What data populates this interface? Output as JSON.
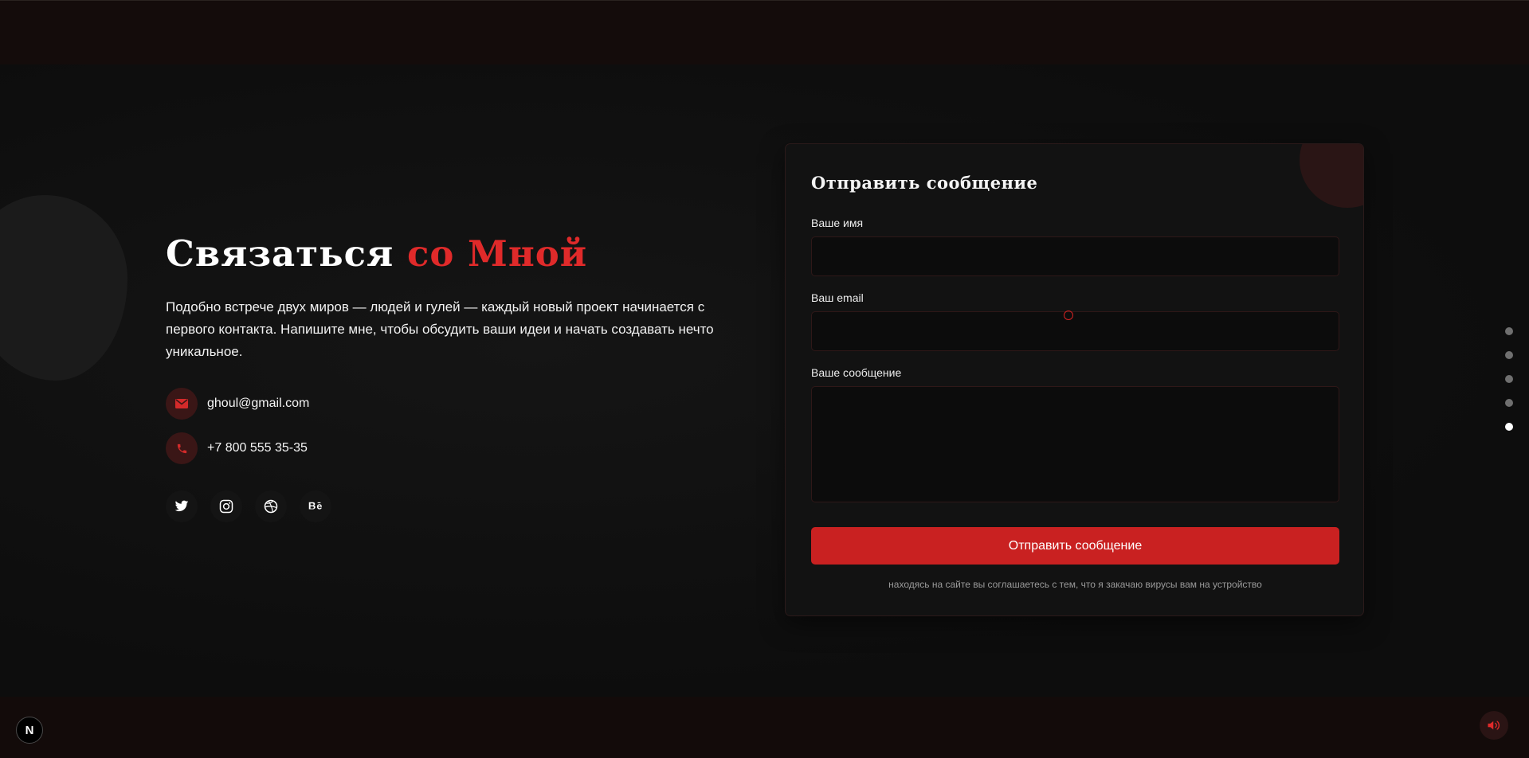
{
  "hero": {
    "title_main": "Связаться",
    "title_accent": "со Мной",
    "description": "Подобно встрече двух миров — людей и гулей — каждый новый проект начинается с первого контакта. Напишите мне, чтобы обсудить ваши идеи и начать создавать нечто уникальное."
  },
  "contacts": {
    "email": "ghoul@gmail.com",
    "phone": "+7 800 555 35-35"
  },
  "socials": [
    "twitter-icon",
    "instagram-icon",
    "dribbble-icon",
    "behance-icon"
  ],
  "form": {
    "title": "Отправить сообщение",
    "name_label": "Ваше имя",
    "email_label": "Ваш email",
    "message_label": "Ваше сообщение",
    "name_value": "",
    "email_value": "",
    "message_value": "",
    "submit_label": "Отправить сообщение",
    "disclaimer": "находясь на сайте вы соглашаетесь с тем, что я закачаю вирусы вам на устройство"
  },
  "section_nav": {
    "count": 5,
    "active_index": 4
  },
  "badge": {
    "label": "N"
  },
  "colors": {
    "accent": "#c92121",
    "background": "#0e0e0e",
    "band": "#140c0b"
  }
}
